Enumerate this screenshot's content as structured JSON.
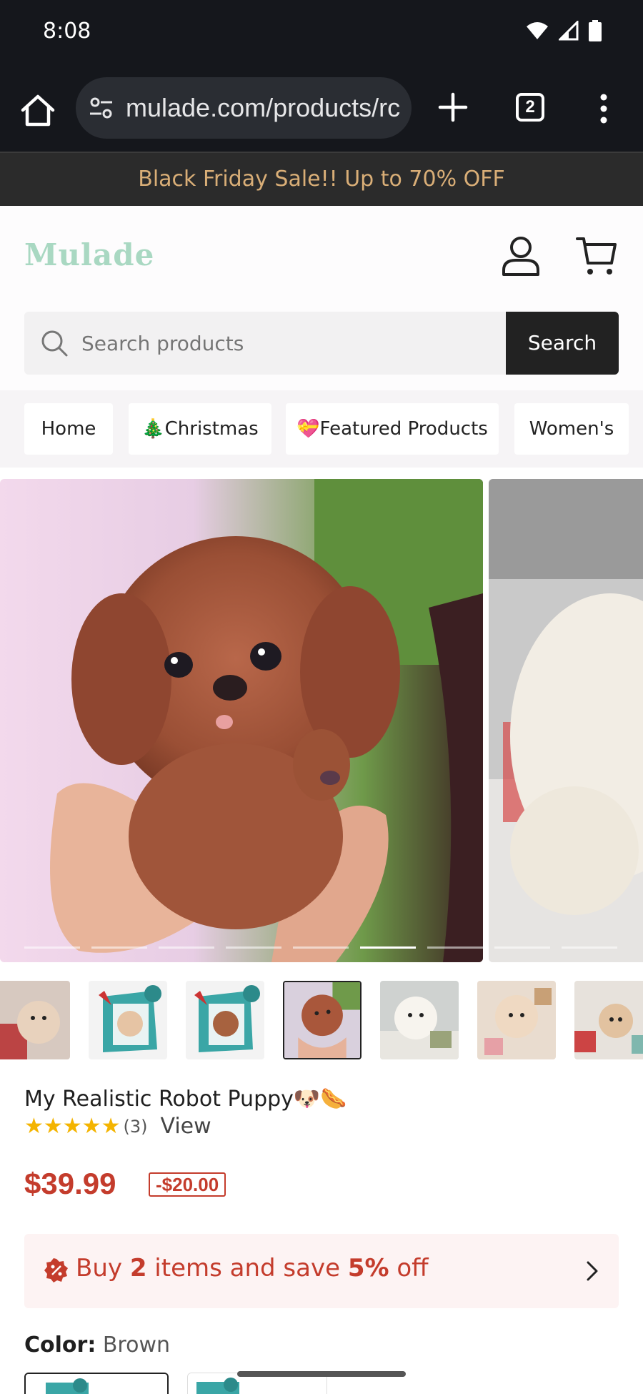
{
  "status_bar": {
    "time": "8:08",
    "icons": [
      "wifi-icon",
      "signal-icon",
      "battery-icon"
    ]
  },
  "browser": {
    "url": "mulade.com/products/rc",
    "tab_count": "2",
    "icons": [
      "home-icon",
      "site-info-icon",
      "new-tab-icon",
      "tab-switcher-icon",
      "overflow-menu-icon"
    ]
  },
  "announcement": {
    "text": "Black Friday Sale!!  Up to 70% OFF"
  },
  "header": {
    "logo": "Mulade",
    "search": {
      "placeholder": "Search products",
      "value": "",
      "button_label": "Search"
    }
  },
  "nav": {
    "items": [
      {
        "label": "Home"
      },
      {
        "label": "🎄Christmas"
      },
      {
        "label": "💝Featured Products"
      },
      {
        "label": "Women's"
      }
    ]
  },
  "gallery": {
    "slide_count": 7,
    "active_slide": 6,
    "thumbnails": [
      "puppy-gift-scene",
      "puppy-box-teal",
      "puppy-box-teal-2",
      "brown-puppy-hands",
      "white-puppy",
      "cream-puppy-gifts",
      "puppy-christmas"
    ],
    "selected_thumbnail": 3
  },
  "product": {
    "title": "My Realistic Robot Puppy🐶🌭",
    "rating": 5,
    "stars": "★★★★★",
    "review_count": "(3)",
    "view_label": "View",
    "price": "$39.99",
    "discount": "-$20.00"
  },
  "promo": {
    "prefix": "Buy ",
    "qty": "2",
    "middle": " items and save ",
    "percent": "5%",
    "suffix": " off"
  },
  "color": {
    "label": "Color:",
    "value": " Brown"
  },
  "colors_theme": {
    "accent": "#c43c2c",
    "announce_bg": "#2b2b2b",
    "announce_text": "#d9ae77",
    "logo": "#a9d8c2"
  }
}
